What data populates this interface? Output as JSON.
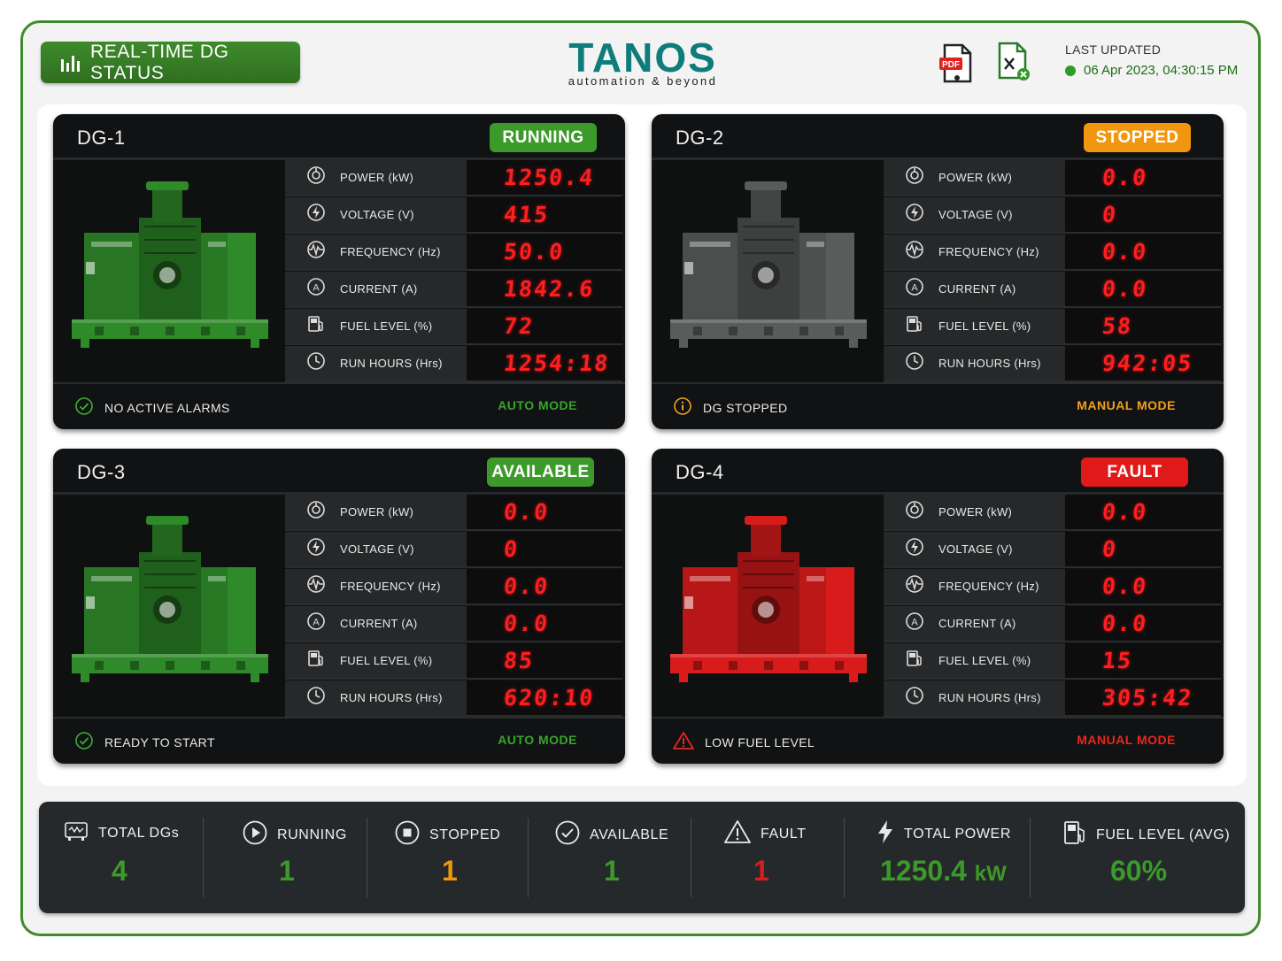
{
  "header": {
    "title": "REAL-TIME DG STATUS",
    "logo_main": "TANOS",
    "logo_tagline": "automation & beyond",
    "export_pdf_icon": "pdf-icon",
    "export_excel_icon": "excel-icon",
    "last_updated_label": "LAST UPDATED",
    "last_updated_value": "06 Apr 2023, 04:30:15 PM"
  },
  "metric_labels": {
    "power": "POWER (kW)",
    "voltage": "VOLTAGE (V)",
    "frequency": "FREQUENCY (Hz)",
    "current": "CURRENT (A)",
    "fuel": "FUEL LEVEL (%)",
    "runhours": "RUN HOURS (Hrs)"
  },
  "generators": [
    {
      "name": "DG-1",
      "status": "RUNNING",
      "status_color": "#3c9a2a",
      "generator_color": "#2f8a2a",
      "power": "1250.4",
      "voltage": "415",
      "frequency": "50.0",
      "current": "1842.6",
      "fuel": "72",
      "runhours": "1254:18",
      "message": "NO ACTIVE ALARMS",
      "message_icon": "check-circle-icon",
      "message_icon_color": "#3cae34",
      "mode": "AUTO MODE",
      "mode_color": "#37a62a"
    },
    {
      "name": "DG-2",
      "status": "STOPPED",
      "status_color": "#f0960f",
      "generator_color": "#5a5c5c",
      "power": "0.0",
      "voltage": "0",
      "frequency": "0.0",
      "current": "0.0",
      "fuel": "58",
      "runhours": "942:05",
      "message": "DG STOPPED",
      "message_icon": "info-circle-icon",
      "message_icon_color": "#f0a020",
      "mode": "MANUAL MODE",
      "mode_color": "#f0a020"
    },
    {
      "name": "DG-3",
      "status": "AVAILABLE",
      "status_color": "#3c9a2a",
      "generator_color": "#2f8a2a",
      "power": "0.0",
      "voltage": "0",
      "frequency": "0.0",
      "current": "0.0",
      "fuel": "85",
      "runhours": "620:10",
      "message": "READY TO START",
      "message_icon": "check-circle-icon",
      "message_icon_color": "#3cae34",
      "mode": "AUTO MODE",
      "mode_color": "#37a62a"
    },
    {
      "name": "DG-4",
      "status": "FAULT",
      "status_color": "#e01a1a",
      "generator_color": "#d81c1c",
      "power": "0.0",
      "voltage": "0",
      "frequency": "0.0",
      "current": "0.0",
      "fuel": "15",
      "runhours": "305:42",
      "message": "LOW FUEL LEVEL",
      "message_icon": "warning-triangle-icon",
      "message_icon_color": "#e8281e",
      "mode": "MANUAL MODE",
      "mode_color": "#e8281e"
    }
  ],
  "summary": [
    {
      "label": "TOTAL DGs",
      "value": "4",
      "icon": "generator-icon",
      "color": "#3c9a2a"
    },
    {
      "label": "RUNNING",
      "value": "1",
      "icon": "play-circle-icon",
      "color": "#3c9a2a"
    },
    {
      "label": "STOPPED",
      "value": "1",
      "icon": "stop-circle-icon",
      "color": "#f0960f"
    },
    {
      "label": "AVAILABLE",
      "value": "1",
      "icon": "check-circle-icon",
      "color": "#3c9a2a"
    },
    {
      "label": "FAULT",
      "value": "1",
      "icon": "warning-triangle-icon",
      "color": "#e01a1a"
    },
    {
      "label": "TOTAL POWER",
      "value": "1250.4",
      "unit": "kW",
      "icon": "lightning-icon",
      "color": "#3c9a2a"
    },
    {
      "label": "FUEL LEVEL (AVG)",
      "value": "60%",
      "icon": "fuel-pump-icon",
      "color": "#3c9a2a"
    }
  ]
}
